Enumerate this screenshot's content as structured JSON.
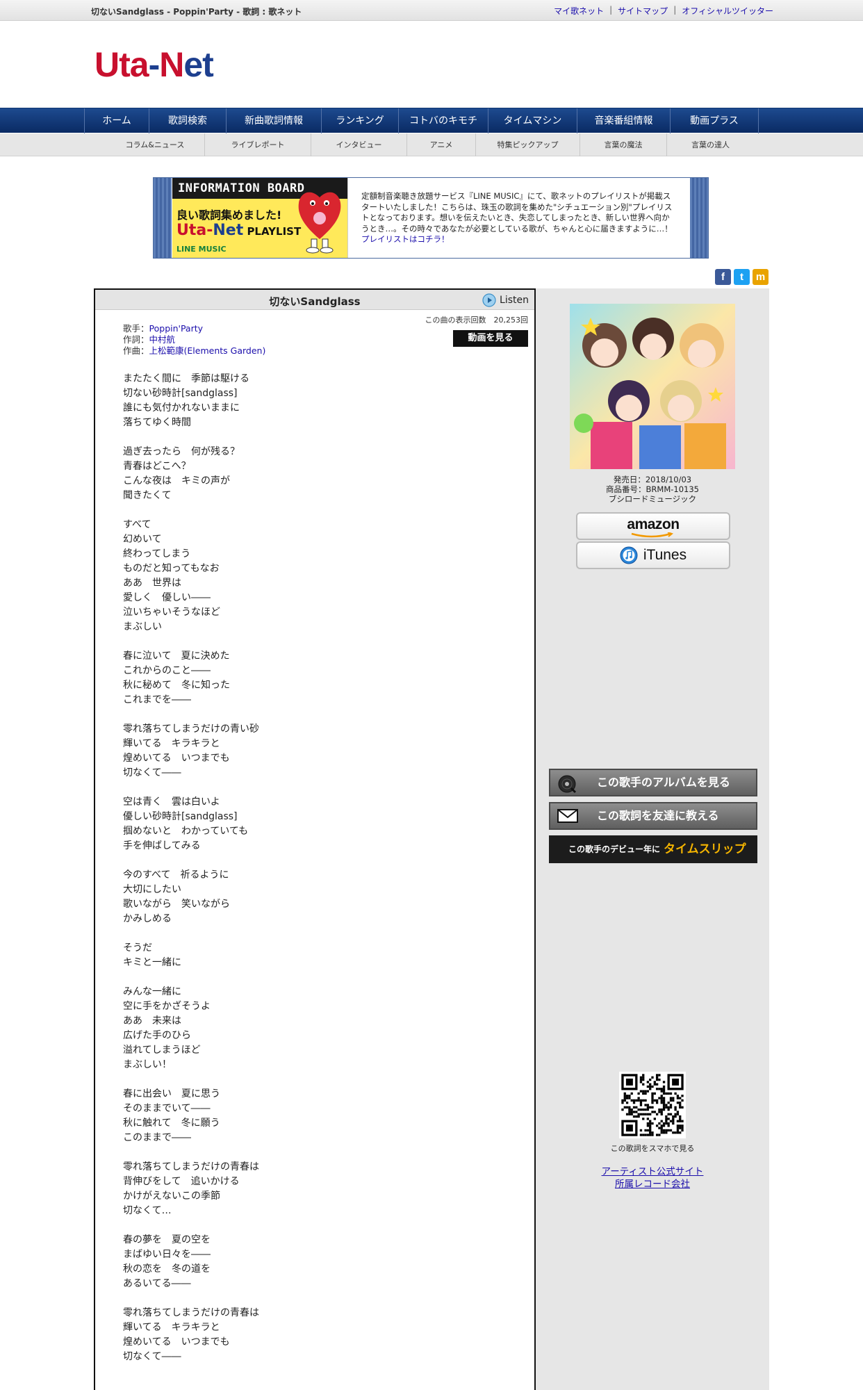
{
  "topbar": {
    "page_title": "切ないSandglass - Poppin'Party - 歌詞 : 歌ネット",
    "links": [
      "マイ歌ネット",
      "サイトマップ",
      "オフィシャルツイッター"
    ]
  },
  "logo": {
    "part1": "Uta",
    "dash": "-",
    "part2a": "N",
    "part2b": "et"
  },
  "main_nav": [
    "ホーム",
    "歌詞検索",
    "新曲歌詞情報",
    "ランキング",
    "コトバのキモチ",
    "タイムマシン",
    "音楽番組情報",
    "動画プラス"
  ],
  "sub_nav": [
    "コラム&ニュース",
    "ライブレポート",
    "インタビュー",
    "アニメ",
    "特集ピックアップ",
    "言葉の魔法",
    "言葉の達人"
  ],
  "info_board": {
    "heading": "INFORMATION BOARD",
    "banner_line1": "良い歌詞集めました!",
    "banner_uta": "Uta-",
    "banner_net": "Net",
    "banner_playlist": " PLAYLIST",
    "banner_service": "LINE MUSIC",
    "text": "定額制音楽聴き放題サービス『LINE MUSIC』にて、歌ネットのプレイリストが掲載スタートいたしました！こちらは、珠玉の歌詞を集めた\"シチュエーション別\"プレイリストとなっております。想いを伝えたいとき、失恋してしまったとき、新しい世界へ向かうとき…。その時々であなたが必要としている歌が、ちゃんと心に届きますように…！",
    "link_text": "プレイリストはコチラ！"
  },
  "social": {
    "facebook": "f",
    "twitter": "t",
    "mixi": "m"
  },
  "song": {
    "title": "切ないSandglass",
    "listen_label": "Listen",
    "views_label": "この曲の表示回数",
    "views": "20,253回",
    "video_button": "動画を見る",
    "singer_label": "歌手：",
    "singer": "Poppin'Party",
    "lyricist_label": "作詞：",
    "lyricist": "中村航",
    "composer_label": "作曲：",
    "composer": "上松範康(Elements Garden)"
  },
  "lyrics": [
    [
      "またたく間に　季節は駆ける",
      "切ない砂時計[sandglass]",
      "誰にも気付かれないままに",
      "落ちてゆく時間"
    ],
    [
      "過ぎ去ったら　何が残る？",
      "青春はどこへ？",
      "こんな夜は　キミの声が",
      "聞きたくて"
    ],
    [
      "すべて",
      "幻めいて",
      "終わってしまう",
      "ものだと知ってもなお",
      "ああ　世界は",
      "愛しく　優しい――",
      "泣いちゃいそうなほど",
      "まぶしい"
    ],
    [
      "春に泣いて　夏に決めた",
      "これからのこと――",
      "秋に秘めて　冬に知った",
      "これまでを――"
    ],
    [
      "零れ落ちてしまうだけの青い砂",
      "輝いてる　キラキラと",
      "煌めいてる　いつまでも",
      "切なくて――"
    ],
    [
      "空は青く　雲は白いよ",
      "優しい砂時計[sandglass]",
      "掴めないと　わかっていても",
      "手を伸ばしてみる"
    ],
    [
      "今のすべて　祈るように",
      "大切にしたい",
      "歌いながら　笑いながら",
      "かみしめる"
    ],
    [
      "そうだ",
      "キミと一緒に"
    ],
    [
      "みんな一緒に",
      "空に手をかざそうよ",
      "ああ　未来は",
      "広げた手のひら",
      "溢れてしまうほど",
      "まぶしい！"
    ],
    [
      "春に出会い　夏に思う",
      "そのままでいて――",
      "秋に触れて　冬に願う",
      "このままで――"
    ],
    [
      "零れ落ちてしまうだけの青春は",
      "背伸びをして　追いかける",
      "かけがえないこの季節",
      "切なくて…"
    ],
    [
      "春の夢を　夏の空を",
      "まばゆい日々を――",
      "秋の恋を　冬の道を",
      "あるいてる――"
    ],
    [
      "零れ落ちてしまうだけの青春は",
      "輝いてる　キラキラと",
      "煌めいてる　いつまでも",
      "切なくて――"
    ]
  ],
  "album": {
    "release_date": "発売日：2018/10/03",
    "product_code": "商品番号：BRMM-10135",
    "label": "ブシロードミュージック",
    "amazon": "amazon",
    "itunes": "iTunes"
  },
  "sidebar_buttons": {
    "album": "この歌手のアルバムを見る",
    "mail": "この歌詞を友達に教える",
    "timeslip_small": "この歌手のデビュー年に",
    "timeslip_big": "タイムスリップ"
  },
  "qr_caption": "この歌詞をスマホで見る",
  "side_links": [
    "アーティスト公式サイト",
    "所属レコード会社"
  ]
}
